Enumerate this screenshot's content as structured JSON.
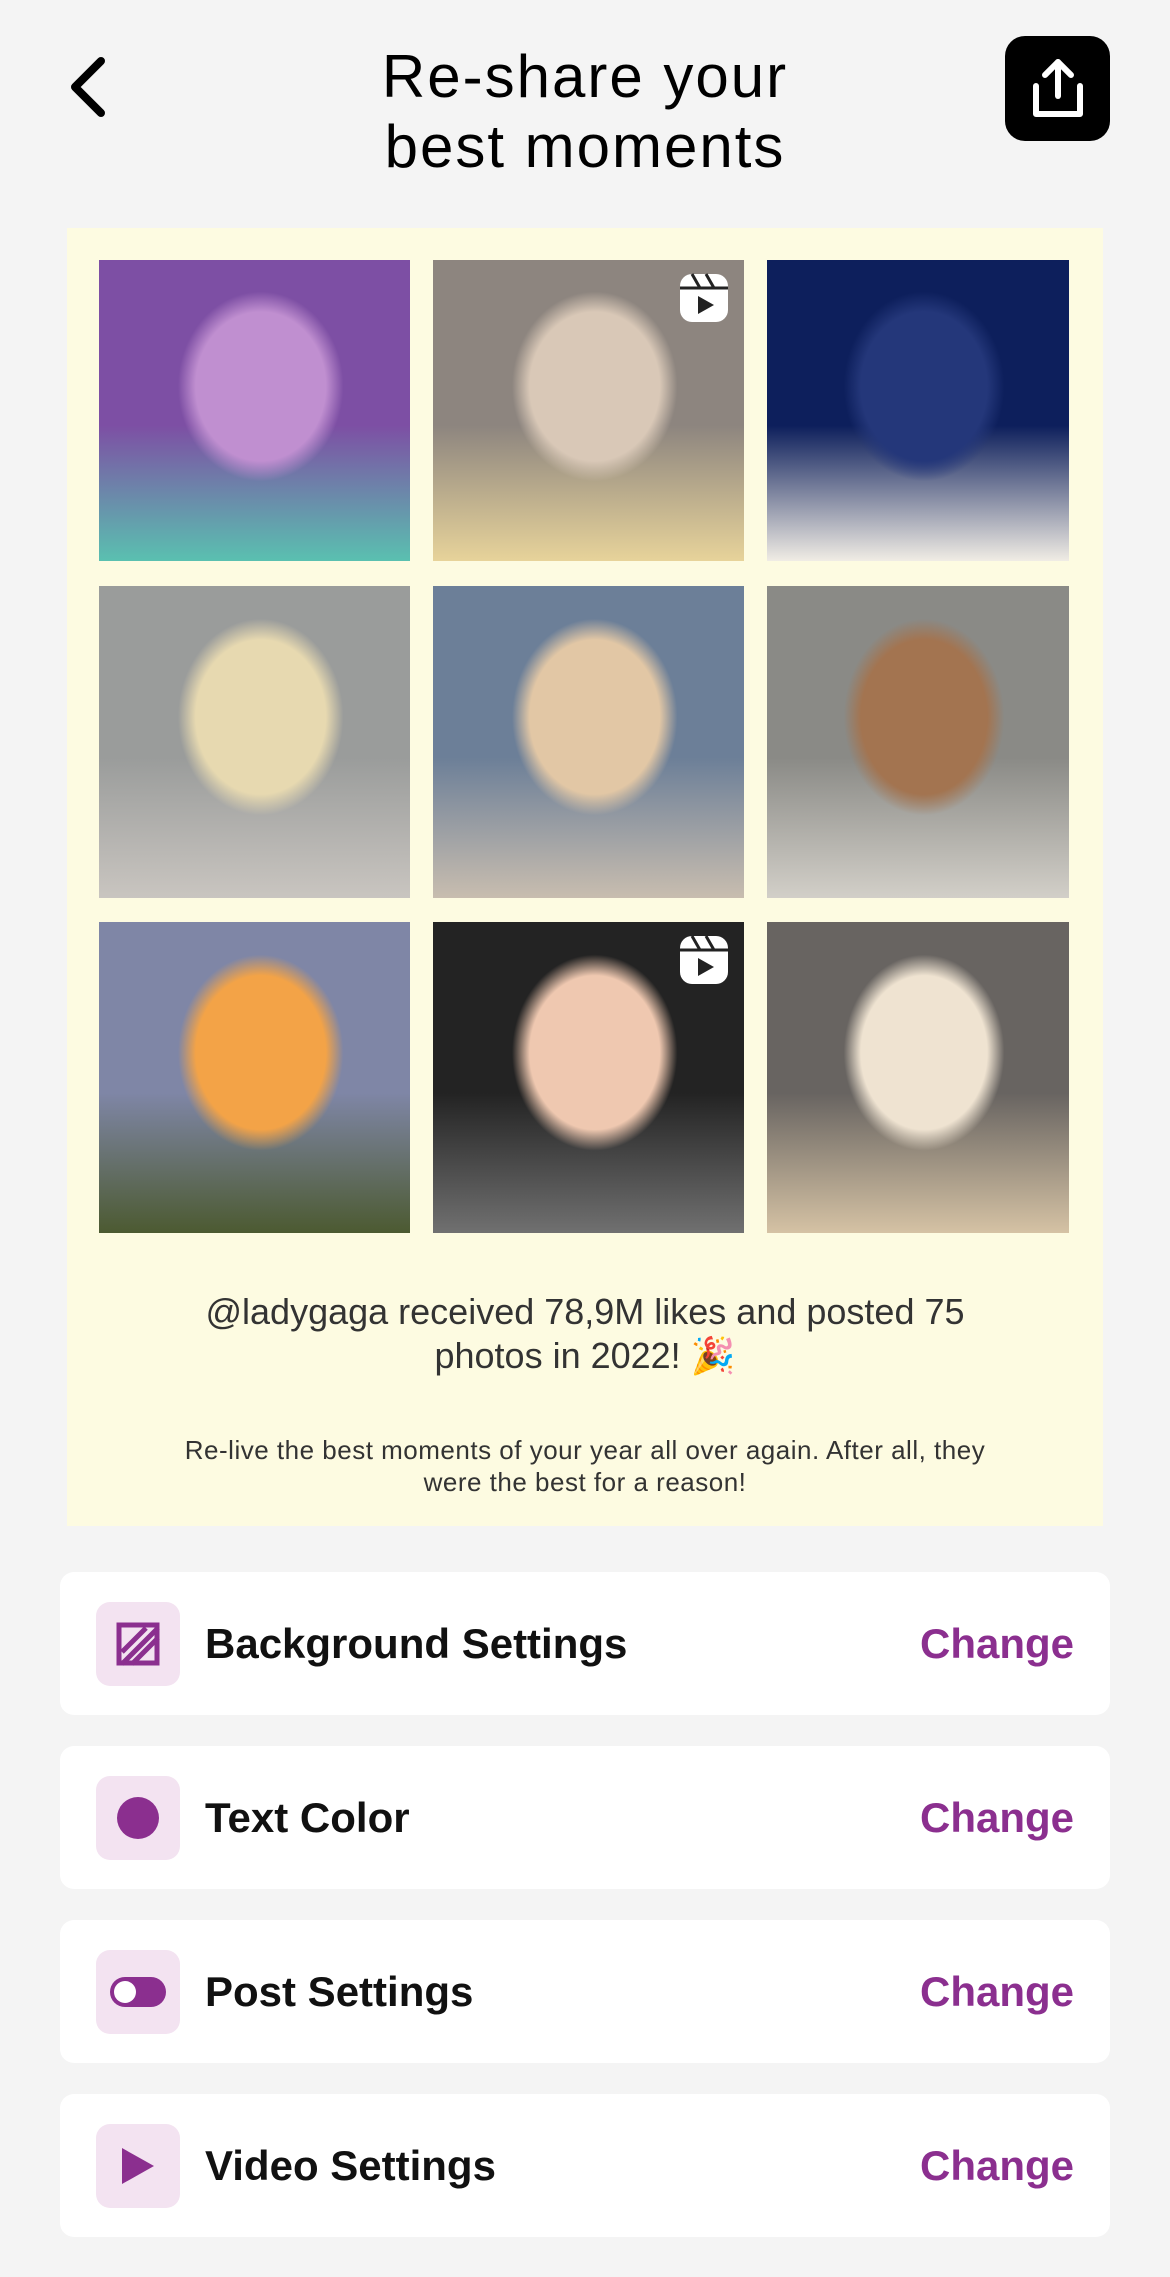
{
  "header": {
    "title_line1": "Re-share your",
    "title_line2": "best moments",
    "back_icon": "chevron-left-icon",
    "share_icon": "share-upload-icon"
  },
  "recap": {
    "photos": [
      {
        "name": "photo-grammy-purple",
        "reel": false,
        "colors": [
          "#7d4fa4",
          "#c08fd0",
          "#5ac0b0"
        ]
      },
      {
        "name": "photo-selfie-video",
        "reel": true,
        "colors": [
          "#8d857f",
          "#d9c8b7",
          "#e7d39a"
        ]
      },
      {
        "name": "photo-white-gown-blue-curtain",
        "reel": false,
        "colors": [
          "#0d1f5c",
          "#24377a",
          "#f0ece4"
        ]
      },
      {
        "name": "photo-portrait-gray",
        "reel": false,
        "colors": [
          "#9a9c9b",
          "#e7d9b0",
          "#c9c5c0"
        ]
      },
      {
        "name": "photo-selfie-window",
        "reel": false,
        "colors": [
          "#6c7f98",
          "#e2c7a5",
          "#c8bdaf"
        ]
      },
      {
        "name": "photo-mirror-selfie",
        "reel": false,
        "colors": [
          "#8a8a86",
          "#a37450",
          "#d2cfc8"
        ]
      },
      {
        "name": "photo-sunset",
        "reel": false,
        "colors": [
          "#7f86a6",
          "#f3a347",
          "#4c5a31"
        ]
      },
      {
        "name": "photo-studded-jacket-video",
        "reel": true,
        "colors": [
          "#232323",
          "#efc8b0",
          "#707070"
        ]
      },
      {
        "name": "photo-sparkle-dress",
        "reel": false,
        "colors": [
          "#686461",
          "#efe3d1",
          "#d5c2a4"
        ]
      }
    ],
    "stats_text": "@ladygaga received 78,9M likes and posted 75 photos in 2022! 🎉",
    "subtitle": "Re-live the best moments of your year all over again. After all, they were the best for a reason!"
  },
  "settings": [
    {
      "icon": "background-pattern-icon",
      "label": "Background Settings",
      "action": "Change"
    },
    {
      "icon": "color-dot-icon",
      "label": "Text Color",
      "action": "Change"
    },
    {
      "icon": "toggle-icon",
      "label": "Post Settings",
      "action": "Change"
    },
    {
      "icon": "play-icon",
      "label": "Video Settings",
      "action": "Change"
    }
  ],
  "colors": {
    "accent": "#8b2f8f",
    "icon_bg": "#f3e3f1",
    "card_bg": "#fdfbe1",
    "page_bg": "#f4f4f4"
  }
}
